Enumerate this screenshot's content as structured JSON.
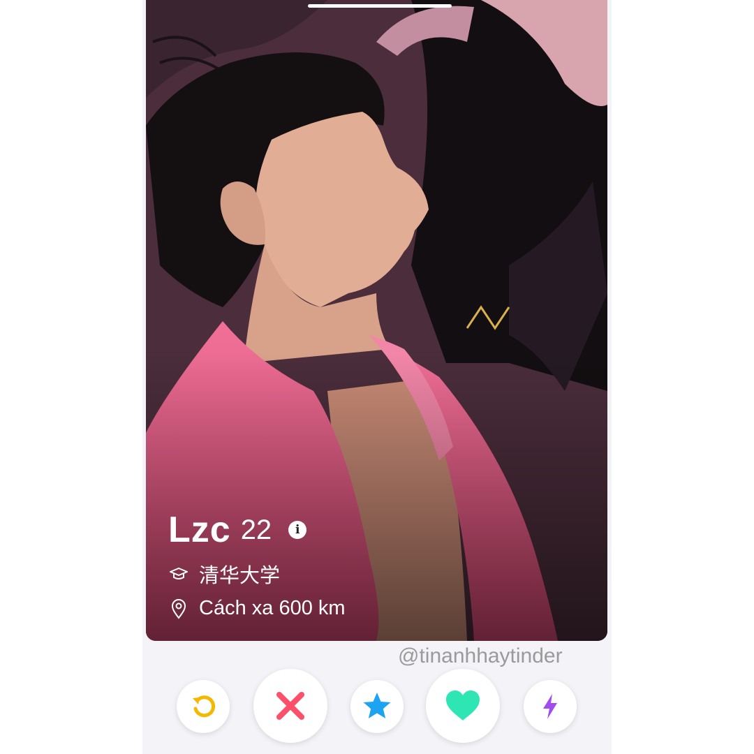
{
  "profile": {
    "name": "Lzc",
    "age": "22",
    "school": "清华大学",
    "distance": "Cách xa 600 km"
  },
  "icons": {
    "info": "info-icon",
    "school": "graduation-cap-icon",
    "location": "location-pin-icon"
  },
  "watermark": "@tinanhhaytinder",
  "actions": [
    {
      "name": "rewind",
      "icon": "rewind-icon",
      "color": "#f5b800"
    },
    {
      "name": "nope",
      "icon": "x-icon",
      "color": "#fd4f68"
    },
    {
      "name": "super-like",
      "icon": "star-icon",
      "color": "#1ca4f3"
    },
    {
      "name": "like",
      "icon": "heart-icon",
      "color": "#2ee6b4"
    },
    {
      "name": "boost",
      "icon": "bolt-icon",
      "color": "#a24bf0"
    }
  ],
  "colors": {
    "towel": "#e9557f",
    "background": "#f4f4f8"
  }
}
